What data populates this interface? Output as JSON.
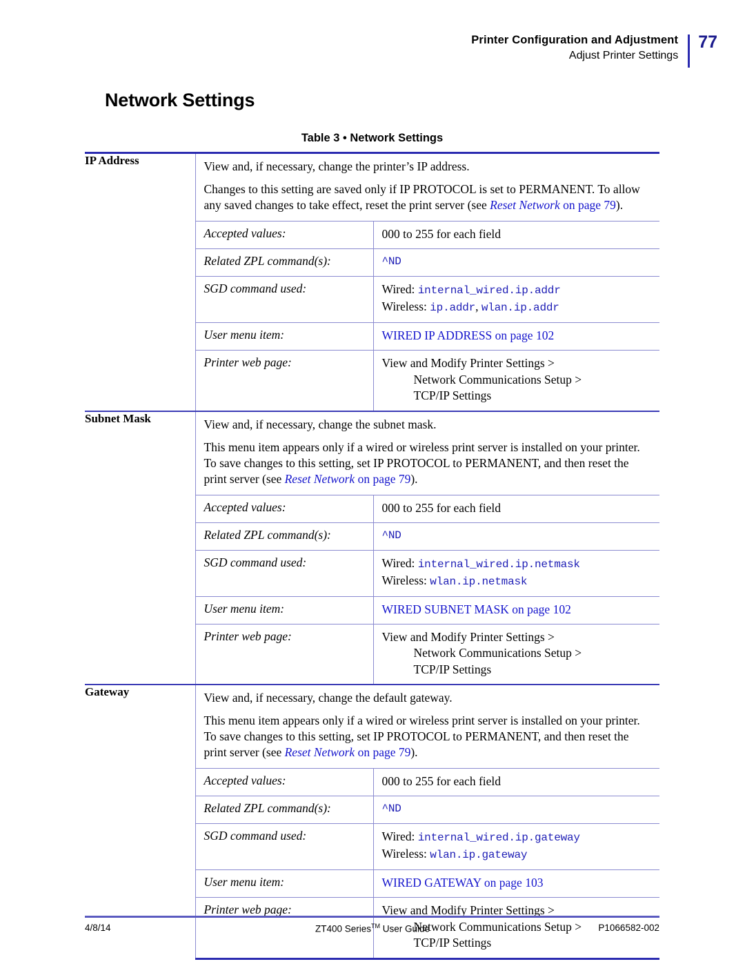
{
  "header": {
    "title": "Printer Configuration and Adjustment",
    "subtitle": "Adjust Printer Settings",
    "page_number": "77",
    "rule_color": "#2b2bb0",
    "page_number_color": "#1a1a8c"
  },
  "section": {
    "title": "Network Settings"
  },
  "table": {
    "caption": "Table 3 • Network Settings",
    "border_color": "#2b2bb0",
    "row_rule_color": "#8a8ad0",
    "link_color": "#1414cc",
    "mono_color": "#1d1db5",
    "sections": [
      {
        "label": "IP Address",
        "description": [
          "View and, if necessary, change the printer’s IP address.",
          "Changes to this setting are saved only if IP PROTOCOL is set to PERMANENT. To allow any saved changes to take effect, reset the print server (see "
        ],
        "desc_link_italic": "Reset Network",
        "desc_link_tail": "on page 79",
        "desc_tail": ").",
        "rows": {
          "accepted_values_label": "Accepted values:",
          "accepted_values": "000 to 255 for each field",
          "zpl_label": "Related ZPL command(s):",
          "zpl_value": "^ND",
          "sgd_label": "SGD command used:",
          "sgd_wired_prefix": "Wired:",
          "sgd_wired_value": "internal_wired.ip.addr",
          "sgd_wireless_prefix": "Wireless:",
          "sgd_wireless_value_1": "ip.addr",
          "sgd_wireless_sep": ",",
          "sgd_wireless_value_2": "wlan.ip.addr",
          "menu_label": "User menu item:",
          "menu_value": "WIRED IP ADDRESS on page 102",
          "web_label": "Printer web page:",
          "web_line1": "View and Modify Printer Settings >",
          "web_line2": "Network Communications Setup >",
          "web_line3": "TCP/IP Settings"
        }
      },
      {
        "label": "Subnet Mask",
        "description": [
          "View and, if necessary, change the subnet mask.",
          "This menu item appears only if a wired or wireless print server is installed on your printer. To save changes to this setting, set IP PROTOCOL to PERMANENT, and then reset the print server (see "
        ],
        "desc_link_italic": "Reset Network",
        "desc_link_tail": "on page 79",
        "desc_tail": ").",
        "rows": {
          "accepted_values_label": "Accepted values:",
          "accepted_values": "000 to 255 for each field",
          "zpl_label": "Related ZPL command(s):",
          "zpl_value": "^ND",
          "sgd_label": "SGD command used:",
          "sgd_wired_prefix": "Wired:",
          "sgd_wired_value": "internal_wired.ip.netmask",
          "sgd_wireless_prefix": "Wireless:",
          "sgd_wireless_value_1": "wlan.ip.netmask",
          "sgd_wireless_sep": "",
          "sgd_wireless_value_2": "",
          "menu_label": "User menu item:",
          "menu_value": "WIRED SUBNET MASK on page 102",
          "web_label": "Printer web page:",
          "web_line1": "View and Modify Printer Settings >",
          "web_line2": "Network Communications Setup >",
          "web_line3": "TCP/IP Settings"
        }
      },
      {
        "label": "Gateway",
        "description": [
          "View and, if necessary, change the default gateway.",
          "This menu item appears only if a wired or wireless print server is installed on your printer. To save changes to this setting, set IP PROTOCOL to PERMANENT, and then reset the print server (see "
        ],
        "desc_link_italic": "Reset Network",
        "desc_link_tail": "on page 79",
        "desc_tail": ").",
        "rows": {
          "accepted_values_label": "Accepted values:",
          "accepted_values": "000 to 255 for each field",
          "zpl_label": "Related ZPL command(s):",
          "zpl_value": "^ND",
          "sgd_label": "SGD command used:",
          "sgd_wired_prefix": "Wired:",
          "sgd_wired_value": "internal_wired.ip.gateway",
          "sgd_wireless_prefix": "Wireless:",
          "sgd_wireless_value_1": "wlan.ip.gateway",
          "sgd_wireless_sep": "",
          "sgd_wireless_value_2": "",
          "menu_label": "User menu item:",
          "menu_value": "WIRED GATEWAY on page 103",
          "web_label": "Printer web page:",
          "web_line1": "View and Modify Printer Settings >",
          "web_line2": "Network Communications Setup >",
          "web_line3": "TCP/IP Settings"
        }
      }
    ]
  },
  "footer": {
    "date": "4/8/14",
    "guide_name": "ZT400 Series",
    "guide_tm": "TM",
    "guide_tail": " User Guide",
    "part_number": "P1066582-002"
  }
}
